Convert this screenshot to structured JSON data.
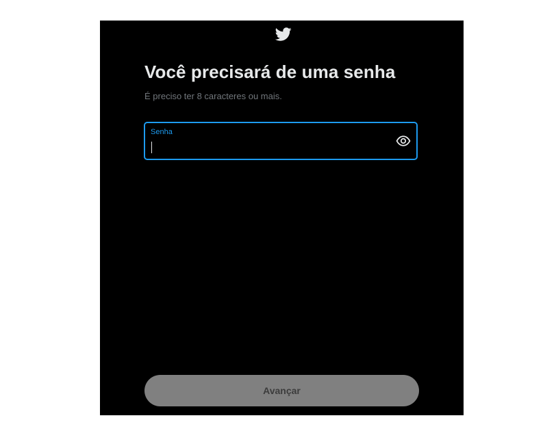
{
  "brand": {
    "logo_icon": "twitter-bird-icon",
    "accent_color": "#1d9bf0"
  },
  "dialog": {
    "title": "Você precisará de uma senha",
    "subtitle": "É preciso ter 8 caracteres ou mais."
  },
  "password_field": {
    "label": "Senha",
    "value": "",
    "toggle_icon": "eye-icon"
  },
  "actions": {
    "next_label": "Avançar",
    "next_enabled": false
  }
}
